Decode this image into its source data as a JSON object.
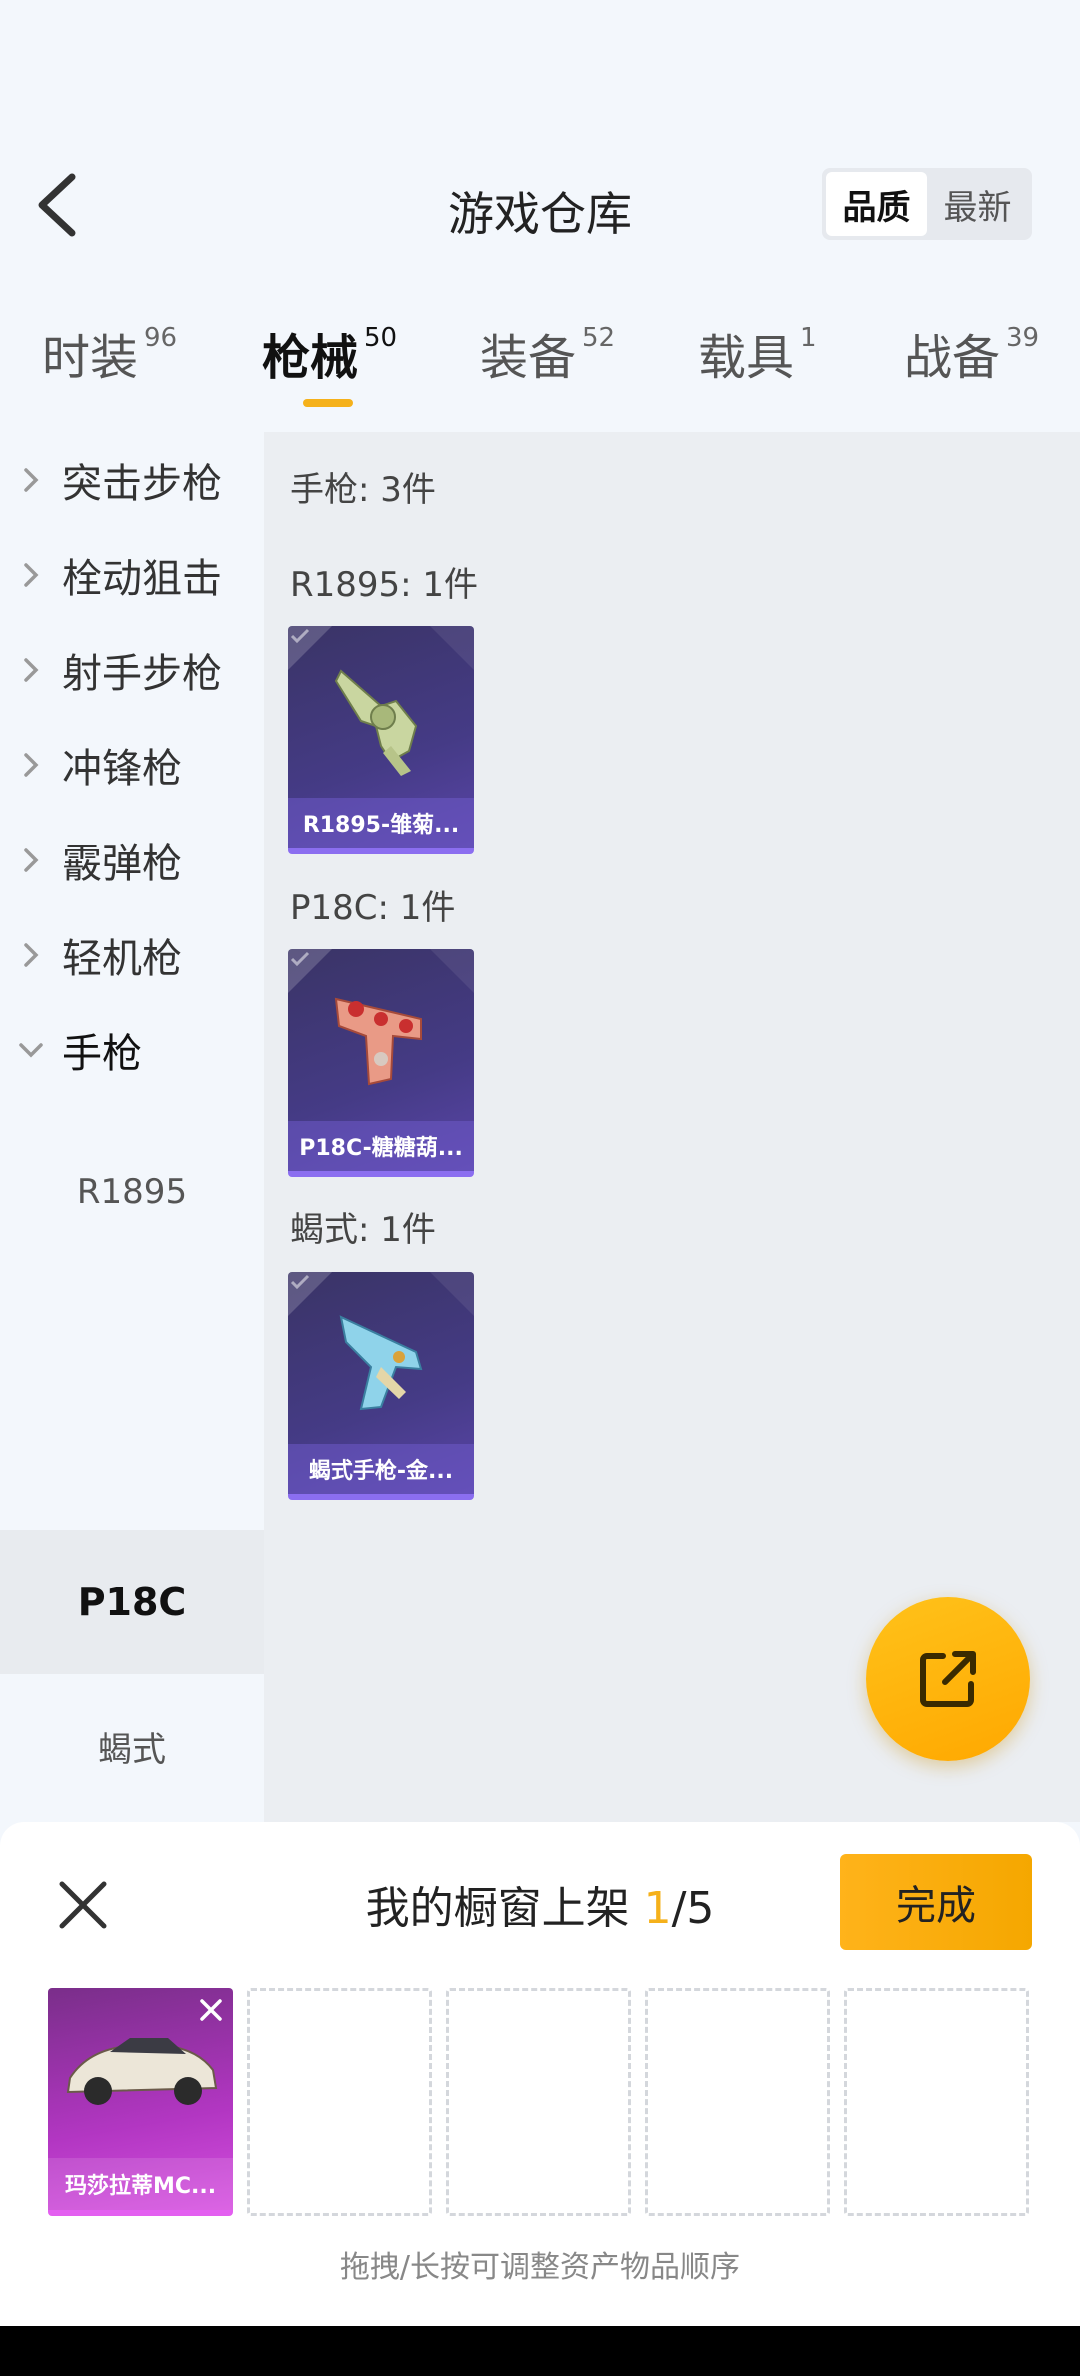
{
  "header": {
    "title": "游戏仓库",
    "sort_options": [
      "品质",
      "最新"
    ],
    "sort_selected": "品质"
  },
  "tabs": [
    {
      "label": "时装",
      "count": "96"
    },
    {
      "label": "枪械",
      "count": "50",
      "active": true
    },
    {
      "label": "装备",
      "count": "52"
    },
    {
      "label": "载具",
      "count": "1"
    },
    {
      "label": "战备",
      "count": "39"
    }
  ],
  "sidebar": {
    "categories": [
      {
        "label": "突击步枪"
      },
      {
        "label": "栓动狙击"
      },
      {
        "label": "射手步枪"
      },
      {
        "label": "冲锋枪"
      },
      {
        "label": "霰弹枪"
      },
      {
        "label": "轻机枪"
      },
      {
        "label": "手枪",
        "expanded": true
      }
    ],
    "subitems": [
      {
        "label": "R1895"
      },
      {
        "label": "P18C",
        "selected": true
      },
      {
        "label": "蝎式"
      }
    ]
  },
  "content": {
    "summary": "手枪: 3件",
    "groups": [
      {
        "title": "R1895: 1件",
        "item_label": "R1895-雏菊...",
        "icon": "revolver-icon"
      },
      {
        "title": "P18C: 1件",
        "item_label": "P18C-糖糖葫...",
        "icon": "pistol-icon"
      },
      {
        "title": "蝎式: 1件",
        "item_label": "蝎式手枪-金...",
        "icon": "machine-pistol-icon"
      }
    ]
  },
  "fab": {
    "icon": "share-external-icon"
  },
  "sheet": {
    "title_prefix": "我的橱窗上架 ",
    "title_count": "1",
    "title_suffix": "/5",
    "done_label": "完成",
    "slots": [
      {
        "label": "玛莎拉蒂MC...",
        "icon": "car-icon"
      },
      {
        "label": ""
      },
      {
        "label": ""
      },
      {
        "label": ""
      },
      {
        "label": ""
      }
    ],
    "hint": "拖拽/长按可调整资产物品顺序"
  },
  "colors": {
    "accent": "#f5b11b",
    "card_purple": "#453b86",
    "slot_magenta": "#b236c2"
  }
}
